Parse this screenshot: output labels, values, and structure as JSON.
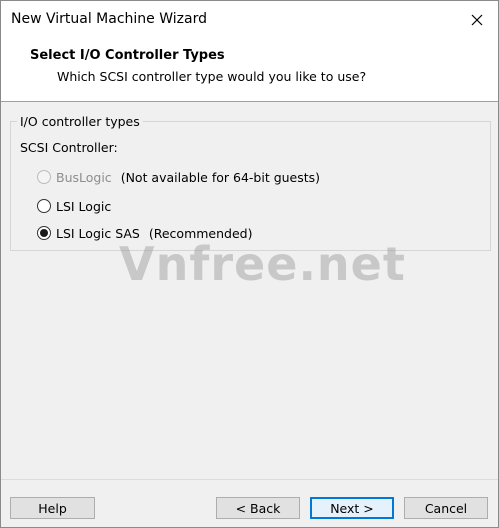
{
  "window": {
    "title": "New Virtual Machine Wizard"
  },
  "header": {
    "title": "Select I/O Controller Types",
    "subtitle": "Which SCSI controller type would you like to use?"
  },
  "group": {
    "legend": "I/O controller types",
    "scsi_label": "SCSI Controller:",
    "options": [
      {
        "label": "BusLogic",
        "note": "(Not available for 64-bit guests)",
        "selected": false,
        "enabled": false
      },
      {
        "label": "LSI Logic",
        "note": "",
        "selected": false,
        "enabled": true
      },
      {
        "label": "LSI Logic SAS",
        "note": "(Recommended)",
        "selected": true,
        "enabled": true
      }
    ]
  },
  "watermark": "Vnfree.net",
  "buttons": {
    "help": "Help",
    "back": "< Back",
    "next": "Next >",
    "cancel": "Cancel"
  },
  "icons": {
    "close": "close-icon"
  },
  "colors": {
    "accent": "#0078d7",
    "header_bg": "#ffffff",
    "body_bg": "#f0f0f0"
  }
}
